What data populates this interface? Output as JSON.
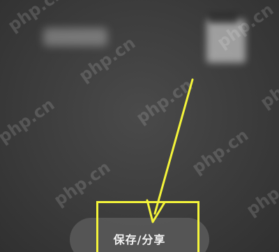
{
  "bottom_bar": {
    "save_share_label": "保存/分享"
  },
  "annotation": {
    "highlight_color": "#f4f43a",
    "arrow_color": "#f4f43a"
  },
  "watermark": {
    "text": "php.cn"
  },
  "colors": {
    "background": "#3c3c3c",
    "label": "#f2f2f2"
  }
}
